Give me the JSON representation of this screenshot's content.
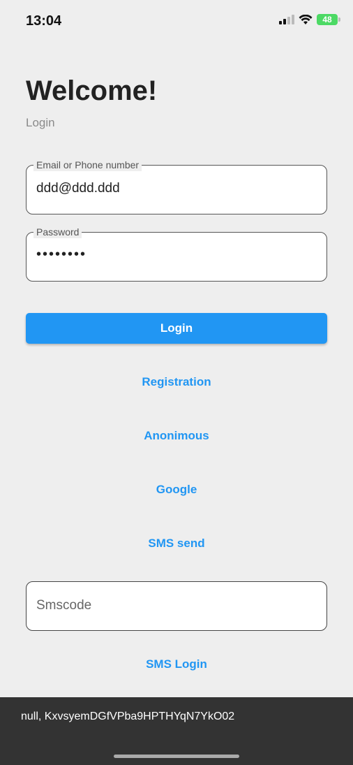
{
  "status_bar": {
    "time": "13:04",
    "battery": "48"
  },
  "header": {
    "title": "Welcome!",
    "subtitle": "Login"
  },
  "email_field": {
    "label": "Email or Phone number",
    "value": "ddd@ddd.ddd"
  },
  "password_field": {
    "label": "Password",
    "value": "••••••••"
  },
  "login_button": {
    "label": "Login"
  },
  "links": {
    "registration": "Registration",
    "anonymous": "Anonimous",
    "google": "Google",
    "sms_send": "SMS send",
    "sms_login": "SMS Login"
  },
  "sms_field": {
    "placeholder": "Smscode"
  },
  "snackbar": {
    "text": "null, KxvsyemDGfVPba9HPTHYqN7YkO02"
  },
  "colors": {
    "primary": "#2196f3",
    "background": "#eeeeee",
    "snackbar": "#333333"
  }
}
